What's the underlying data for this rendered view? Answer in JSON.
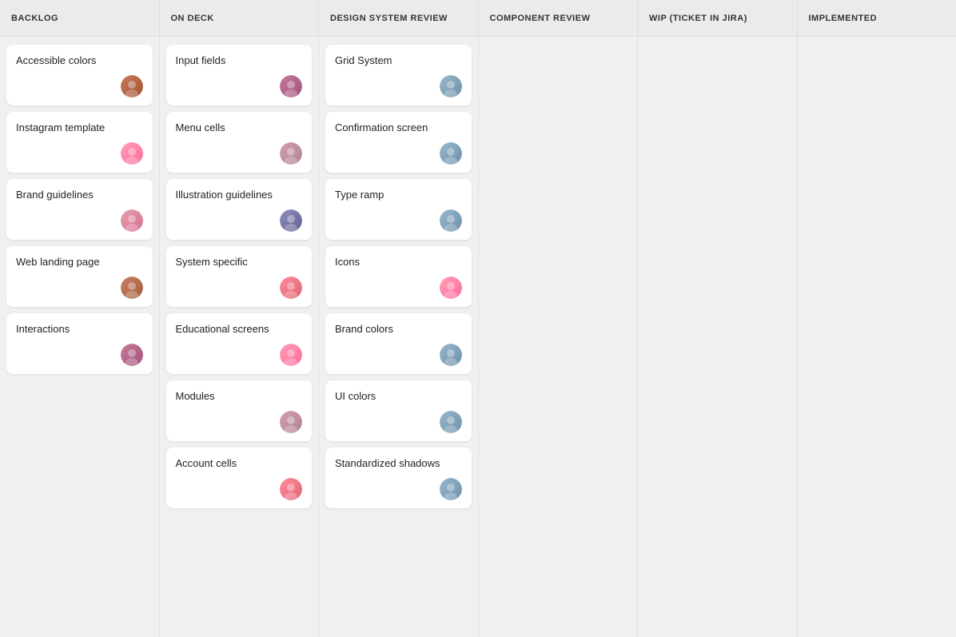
{
  "columns": [
    {
      "id": "backlog",
      "header": "BACKLOG",
      "cards": [
        {
          "id": "accessible-colors",
          "title": "Accessible colors",
          "avatar": "avatar-1"
        },
        {
          "id": "instagram-template",
          "title": "Instagram template",
          "avatar": "avatar-pink"
        },
        {
          "id": "brand-guidelines",
          "title": "Brand guidelines",
          "avatar": "avatar-3"
        },
        {
          "id": "web-landing-page",
          "title": "Web landing page",
          "avatar": "avatar-5"
        },
        {
          "id": "interactions",
          "title": "Interactions",
          "avatar": "avatar-2"
        }
      ]
    },
    {
      "id": "on-deck",
      "header": "ON DECK",
      "cards": [
        {
          "id": "input-fields",
          "title": "Input fields",
          "avatar": "avatar-2"
        },
        {
          "id": "menu-cells",
          "title": "Menu cells",
          "avatar": "avatar-7"
        },
        {
          "id": "illustration-guidelines",
          "title": "Illustration guidelines",
          "avatar": "avatar-8"
        },
        {
          "id": "system-specific",
          "title": "System specific",
          "avatar": "avatar-9"
        },
        {
          "id": "educational-screens",
          "title": "Educational screens",
          "avatar": "avatar-pink"
        },
        {
          "id": "modules",
          "title": "Modules",
          "avatar": "avatar-7"
        },
        {
          "id": "account-cells",
          "title": "Account cells",
          "avatar": "avatar-9"
        }
      ]
    },
    {
      "id": "design-system-review",
      "header": "DESIGN SYSTEM REVIEW",
      "cards": [
        {
          "id": "grid-system",
          "title": "Grid System",
          "avatar": "avatar-6"
        },
        {
          "id": "confirmation-screen",
          "title": "Confirmation screen",
          "avatar": "avatar-6"
        },
        {
          "id": "type-ramp",
          "title": "Type ramp",
          "avatar": "avatar-6"
        },
        {
          "id": "icons",
          "title": "Icons",
          "avatar": "avatar-pink"
        },
        {
          "id": "brand-colors",
          "title": "Brand colors",
          "avatar": "avatar-6"
        },
        {
          "id": "ui-colors",
          "title": "UI colors",
          "avatar": "avatar-6"
        },
        {
          "id": "standardized-shadows",
          "title": "Standardized shadows",
          "avatar": "avatar-6"
        }
      ]
    },
    {
      "id": "component-review",
      "header": "COMPONENT REVIEW",
      "cards": []
    },
    {
      "id": "wip-ticket-in-jira",
      "header": "WIP (TICKET IN JIRA)",
      "cards": []
    },
    {
      "id": "implemented",
      "header": "IMPLEMENTED",
      "cards": []
    }
  ]
}
